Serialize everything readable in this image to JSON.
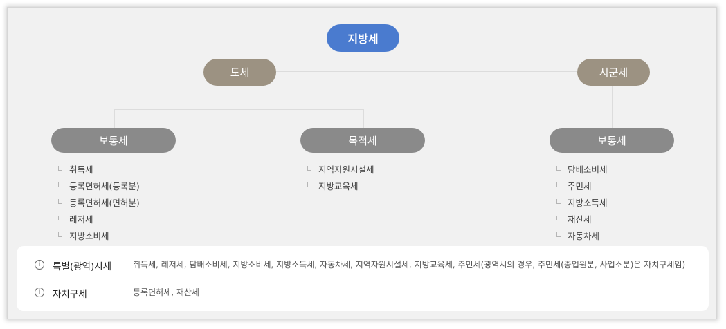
{
  "tree": {
    "root": "지방세",
    "provincial": {
      "label": "도세",
      "ordinary": {
        "label": "보통세",
        "items": [
          "취득세",
          "등록면허세(등록분)",
          "등록면허세(면허분)",
          "레저세",
          "지방소비세"
        ]
      },
      "purpose": {
        "label": "목적세",
        "items": [
          "지역자원시설세",
          "지방교육세"
        ]
      }
    },
    "municipal": {
      "label": "시군세",
      "ordinary": {
        "label": "보통세",
        "items": [
          "담배소비세",
          "주민세",
          "지방소득세",
          "재산세",
          "자동차세"
        ]
      }
    }
  },
  "notes": [
    {
      "icon": "info-icon",
      "glyph": "i",
      "label": "특별(광역)시세",
      "desc": "취득세, 레저세, 담배소비세, 지방소비세, 지방소득세, 자동차세, 지역자원시설세, 지방교육세, 주민세(광역시의 경우, 주민세(종업원분, 사업소분)은 자치구세임)"
    },
    {
      "icon": "info-icon",
      "glyph": "i",
      "label": "자치구세",
      "desc": "등록면허세, 재산세"
    }
  ],
  "colors": {
    "root": "#4a7bcf",
    "mid": "#9c9282",
    "leaf": "#8a8a8a",
    "background": "#f1f1f1"
  }
}
